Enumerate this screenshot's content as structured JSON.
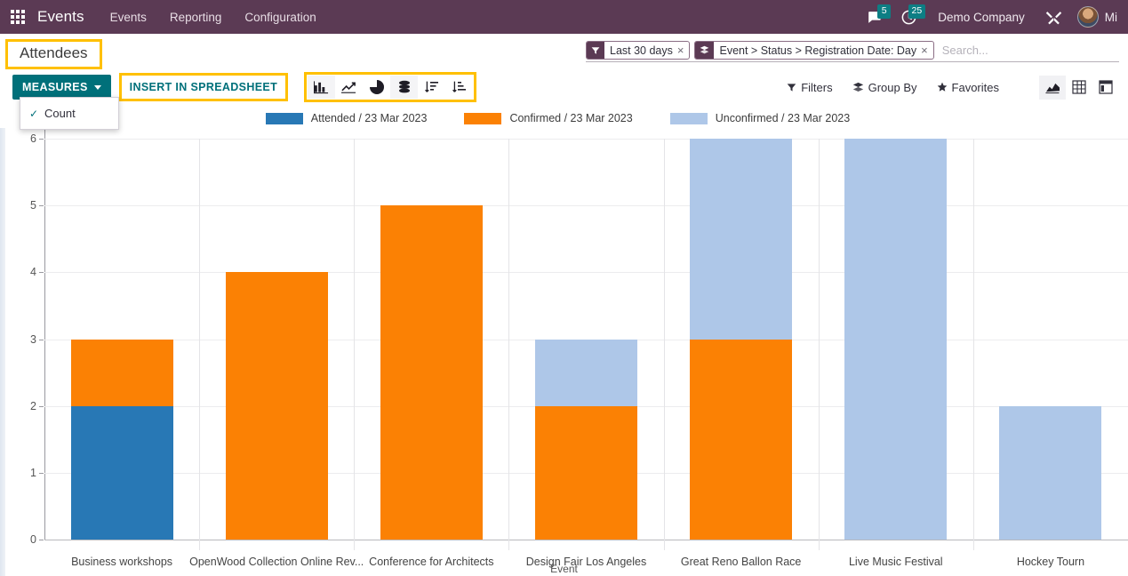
{
  "navbar": {
    "apps_icon": "grid-apps-icon",
    "brand": "Events",
    "menus": [
      {
        "label": "Events"
      },
      {
        "label": "Reporting"
      },
      {
        "label": "Configuration"
      }
    ],
    "messages_icon": "chat-bubble-icon",
    "messages_count": "5",
    "activities_icon": "clock-activity-icon",
    "activities_count": "25",
    "company": "Demo Company",
    "debug_icon": "tools-wrench-icon",
    "avatar_icon": "user-avatar",
    "user": "Mi"
  },
  "control_panel": {
    "breadcrumb": "Attendees",
    "measures_label": "MEASURES",
    "measures_caret": "chevron-down-icon",
    "insert_label": "INSERT IN SPREADSHEET",
    "graph_buttons": [
      {
        "name": "bar-chart-icon",
        "title": "Bar Chart",
        "active": true
      },
      {
        "name": "line-chart-icon",
        "title": "Line Chart",
        "active": false
      },
      {
        "name": "pie-chart-icon",
        "title": "Pie Chart",
        "active": false
      },
      {
        "name": "stacked-icon",
        "title": "Stacked",
        "active": true
      },
      {
        "name": "sort-descending-icon",
        "title": "Descending",
        "active": false
      },
      {
        "name": "sort-ascending-icon",
        "title": "Ascending",
        "active": false
      }
    ],
    "search_facets": [
      {
        "icon": "filter-funnel-icon",
        "label": "Last 30 days",
        "remove": "×"
      },
      {
        "icon": "group-layers-icon",
        "label": "Event > Status > Registration Date: Day",
        "remove": "×"
      }
    ],
    "search_placeholder": "Search...",
    "filters_label": "Filters",
    "filters_icon": "filter-funnel-icon",
    "groupby_label": "Group By",
    "groupby_icon": "group-layers-icon",
    "favorites_label": "Favorites",
    "favorites_icon": "star-icon",
    "view_switcher": [
      {
        "name": "graph-view-icon",
        "title": "Graph",
        "active": true
      },
      {
        "name": "pivot-view-icon",
        "title": "Pivot",
        "active": false
      },
      {
        "name": "kanban-view-icon",
        "title": "Kanban",
        "active": false
      }
    ]
  },
  "measures_dropdown": {
    "open": true,
    "items": [
      {
        "label": "Count",
        "checked": true,
        "check_icon": "checkmark-icon"
      }
    ]
  },
  "colors": {
    "navbar": "#5b3a54",
    "teal": "#00707a",
    "highlight": "#ffc000",
    "attended": "#2878b5",
    "confirmed": "#fb8104",
    "unconfirmed": "#aec7e8"
  },
  "chart_data": {
    "type": "bar",
    "stacked": true,
    "title": "Attendees",
    "xlabel": "Event",
    "ylabel": "",
    "ylim": [
      0,
      6
    ],
    "yticks": [
      0,
      1,
      2,
      3,
      4,
      5,
      6
    ],
    "grid": true,
    "legend_position": "top",
    "measure": "Count",
    "categories": [
      "Business workshops",
      "OpenWood Collection Online Rev...",
      "Conference for Architects",
      "Design Fair Los Angeles",
      "Great Reno Ballon Race",
      "Live Music Festival",
      "Hockey Tourn"
    ],
    "series": [
      {
        "name": "Attended / 23 Mar 2023",
        "color": "#2878b5",
        "values": [
          2,
          0,
          0,
          0,
          0,
          0,
          0
        ]
      },
      {
        "name": "Confirmed / 23 Mar 2023",
        "color": "#fb8104",
        "values": [
          1,
          4,
          5,
          2,
          3,
          0,
          0
        ]
      },
      {
        "name": "Unconfirmed / 23 Mar 2023",
        "color": "#aec7e8",
        "values": [
          0,
          0,
          0,
          1,
          3,
          6,
          2
        ]
      }
    ],
    "totals": [
      3,
      4,
      5,
      3,
      6,
      6,
      2
    ]
  }
}
